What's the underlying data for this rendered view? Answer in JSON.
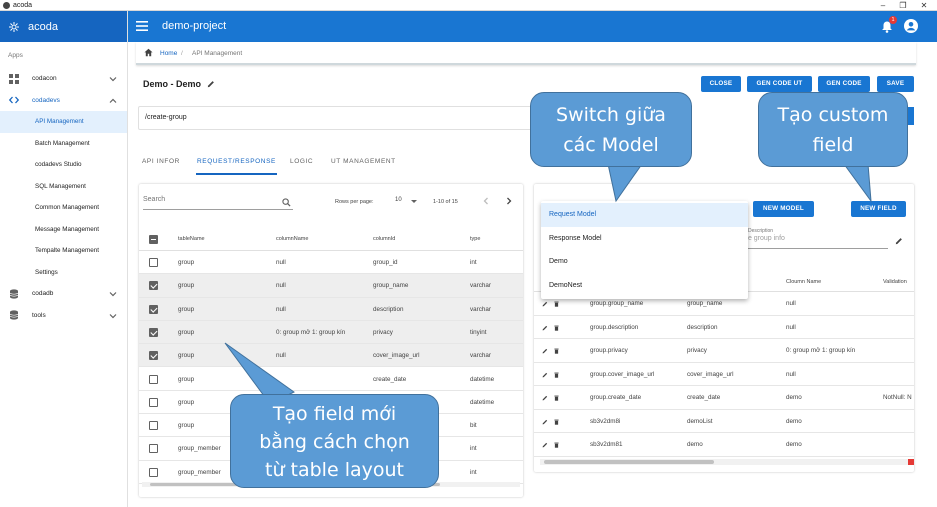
{
  "window": {
    "title": "acoda",
    "controls": [
      "–",
      "❐",
      "✕"
    ]
  },
  "brand": {
    "name": "acoda"
  },
  "sidebar": {
    "section_label": "Apps",
    "items": [
      {
        "label": "codacon",
        "icon": "grid-icon",
        "expanded": false
      },
      {
        "label": "codadevs",
        "icon": "code-icon",
        "expanded": true
      },
      {
        "label": "codadb",
        "icon": "database-icon",
        "expanded": false
      },
      {
        "label": "tools",
        "icon": "database-icon",
        "expanded": false
      }
    ],
    "subitems": [
      "API Management",
      "Batch Management",
      "codadevs Studio",
      "SQL Management",
      "Common Management",
      "Message Management",
      "Tempalte Management",
      "Settings"
    ],
    "active_subitem": "API Management"
  },
  "appbar": {
    "project": "demo-project",
    "notification_count": "1"
  },
  "breadcrumb": {
    "home": "Home",
    "separator": "/",
    "current": "API Management"
  },
  "page": {
    "title": "Demo - Demo",
    "path": "/create-group",
    "buttons": {
      "close": "CLOSE",
      "gen_code_ut": "GEN CODE UT",
      "gen_code": "GEN CODE",
      "save": "SAVE"
    }
  },
  "tabs": [
    "API INFOR",
    "REQUEST/RESPONSE",
    "LOGIC",
    "UT MANAGEMENT"
  ],
  "active_tab": "REQUEST/RESPONSE",
  "left_table": {
    "search_placeholder": "Search",
    "rows_per_page_label": "Rows per page:",
    "rows_per_page": "10",
    "range": "1-10 of 15",
    "columns": [
      "tableName",
      "columnName",
      "columnId",
      "type"
    ],
    "rows": [
      {
        "checked": false,
        "cells": [
          "group",
          "null",
          "group_id",
          "int"
        ]
      },
      {
        "checked": true,
        "cells": [
          "group",
          "null",
          "group_name",
          "varchar"
        ]
      },
      {
        "checked": true,
        "cells": [
          "group",
          "null",
          "description",
          "varchar"
        ]
      },
      {
        "checked": true,
        "cells": [
          "group",
          "0: group mở 1: group kín",
          "privacy",
          "tinyint"
        ]
      },
      {
        "checked": true,
        "cells": [
          "group",
          "null",
          "cover_image_url",
          "varchar"
        ]
      },
      {
        "checked": false,
        "cells": [
          "group",
          "",
          "create_date",
          "datetime"
        ]
      },
      {
        "checked": false,
        "cells": [
          "group",
          "",
          "",
          "datetime"
        ]
      },
      {
        "checked": false,
        "cells": [
          "group",
          "",
          "",
          "bit"
        ]
      },
      {
        "checked": false,
        "cells": [
          "group_member",
          "",
          "",
          "int"
        ]
      },
      {
        "checked": false,
        "cells": [
          "group_member",
          "",
          "",
          "int"
        ]
      }
    ]
  },
  "right_panel": {
    "buttons": {
      "new_model": "NEW MODEL",
      "new_field": "NEW FIELD"
    },
    "description_label": "Description",
    "description_placeholder": "te group info",
    "columns": [
      "",
      "Cloumn Name",
      "Validation"
    ],
    "rows": [
      [
        "group.group_name",
        "group_name",
        "null",
        ""
      ],
      [
        "group.description",
        "description",
        "null",
        ""
      ],
      [
        "group.privacy",
        "privacy",
        "0: group mở 1: group kín",
        ""
      ],
      [
        "group.cover_image_url",
        "cover_image_url",
        "null",
        ""
      ],
      [
        "group.create_date",
        "create_date",
        "demo",
        "NotNull: N"
      ],
      [
        "sb3v2dm8i",
        "demoList",
        "demo",
        ""
      ],
      [
        "sb3v2dm81",
        "demo",
        "demo",
        ""
      ]
    ]
  },
  "model_menu": {
    "items": [
      "Request Model",
      "Response Model",
      "Demo",
      "DemoNest"
    ],
    "selected": "Request Model"
  },
  "callouts": {
    "switch_model": {
      "line1": "Switch giữa",
      "line2": "các Model"
    },
    "custom_field": {
      "line1": "Tạo custom",
      "line2": "field"
    },
    "field_from_table": {
      "line1": "Tạo field mới",
      "line2": "bằng cách chọn",
      "line3": "từ table layout"
    }
  },
  "colors": {
    "primary": "#1976d2",
    "brand_bar": "#1565c0",
    "callout": "#5b9bd5",
    "badge": "#e53935"
  }
}
